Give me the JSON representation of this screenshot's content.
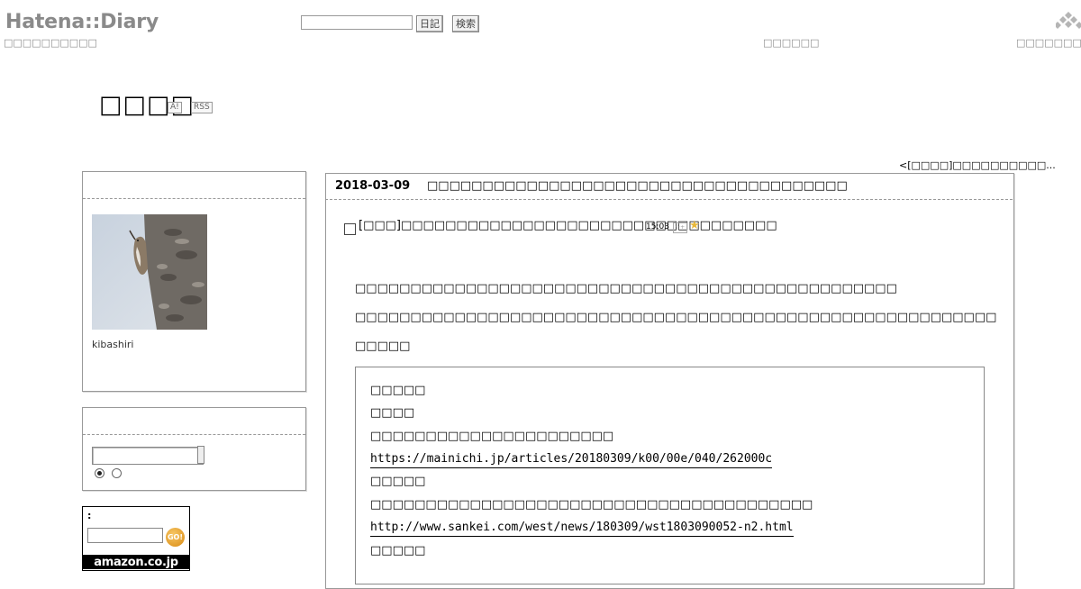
{
  "header": {
    "logo": "Hatena::Diary",
    "sub_text": "□□□□□□□□□□",
    "search_placeholder": "",
    "diary_button": "日記",
    "search_button": "検索",
    "mid_text": "□□□□□□",
    "right_text": "□□□□□□□□□□",
    "hatena_mark": "hatena-logo-icon"
  },
  "diary": {
    "title": "□□□□",
    "badge_a": "A!",
    "badge_rss": "RSS"
  },
  "sidebar": {
    "profile_name": "kibashiri",
    "amazon_label": ":",
    "go_label": "GO!",
    "amazon_logo": "amazon.co.jp"
  },
  "main": {
    "prev_link": "<[□□□□]□□□□□□□□□□...",
    "entry_date": "2018-03-09",
    "entry_title": "□□□□□□□□□□□□□□□□□□□□□□□□□□□□□□□□□□□□□□",
    "section_title": "[□□□]□□□□□□□□□□□□□□□□□□□□□□□□□□□□□□□□□□",
    "section_time": "15:03",
    "para1": "□□□□□□□□□□□□□□□□□□□□□□□□□□□□□□□□□□□□□□□□□□□□□□□□□",
    "para2": "□□□□□□□□□□□□□□□□□□□□□□□□□□□□□□□□□□□□□□□□□□□□□□□□□□□□□□□□□□",
    "para3": "□□□□□",
    "quote": {
      "line1": "□□□□□",
      "line2": "□□□□",
      "line3": "□□□□□□□□□□□□□□□□□□□□□□",
      "link1": "https://mainichi.jp/articles/20180309/k00/00e/040/262000c",
      "line4": "□□□□□",
      "line5": "□□□□□□□□□□□□□□□□□□□□□□□□□□□□□□□□□□□□□□□□",
      "link2": "http://www.sankei.com/west/news/180309/wst1803090052-n2.html",
      "line6": "□□□□□"
    }
  }
}
